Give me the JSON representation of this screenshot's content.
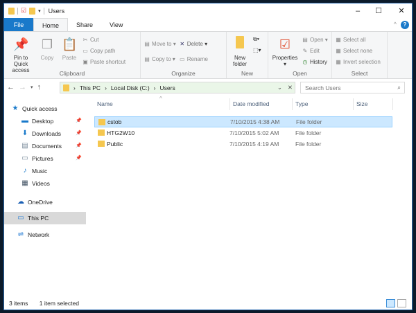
{
  "title": "Users",
  "tabs": [
    "File",
    "Home",
    "Share",
    "View"
  ],
  "ribbon": {
    "clipboard": {
      "label": "Clipboard",
      "pin": "Pin to Quick access",
      "copy": "Copy",
      "paste": "Paste",
      "cut": "Cut",
      "copy_path": "Copy path",
      "paste_shortcut": "Paste shortcut"
    },
    "organize": {
      "label": "Organize",
      "move_to": "Move to",
      "copy_to": "Copy to",
      "delete": "Delete",
      "rename": "Rename"
    },
    "new": {
      "label": "New",
      "new_folder": "New folder"
    },
    "open": {
      "label": "Open",
      "properties": "Properties",
      "open": "Open",
      "edit": "Edit",
      "history": "History"
    },
    "select": {
      "label": "Select",
      "select_all": "Select all",
      "select_none": "Select none",
      "invert": "Invert selection"
    }
  },
  "address": {
    "crumbs": [
      "This PC",
      "Local Disk (C:)",
      "Users"
    ],
    "search_placeholder": "Search Users"
  },
  "nav": {
    "quick_access": "Quick access",
    "items": [
      "Desktop",
      "Downloads",
      "Documents",
      "Pictures",
      "Music",
      "Videos"
    ],
    "onedrive": "OneDrive",
    "thispc": "This PC",
    "network": "Network"
  },
  "columns": [
    "Name",
    "Date modified",
    "Type",
    "Size"
  ],
  "files": [
    {
      "name": "cstob",
      "date": "7/10/2015 4:38 AM",
      "type": "File folder"
    },
    {
      "name": "HTG2W10",
      "date": "7/10/2015 5:02 AM",
      "type": "File folder"
    },
    {
      "name": "Public",
      "date": "7/10/2015 4:19 AM",
      "type": "File folder"
    }
  ],
  "status": {
    "count": "3 items",
    "selected": "1 item selected"
  },
  "accent": "#1979ca"
}
